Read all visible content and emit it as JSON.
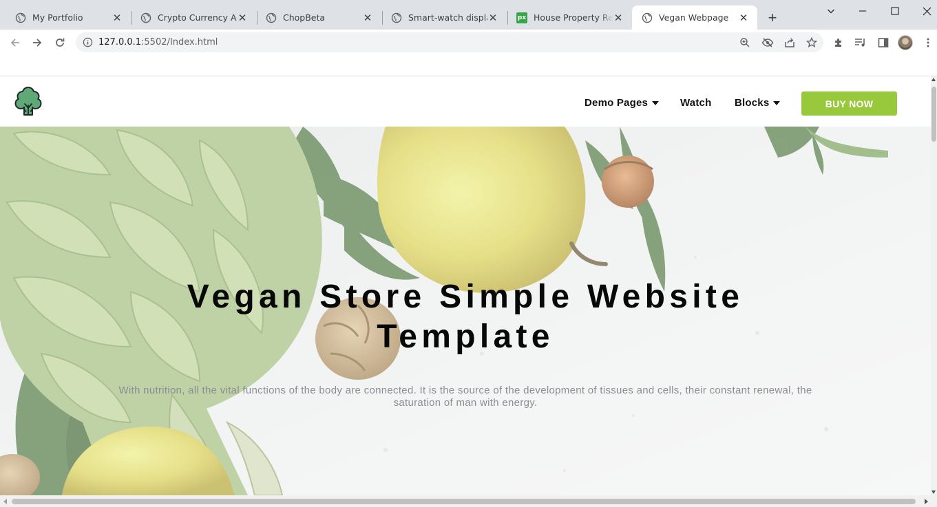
{
  "browser": {
    "tabs": [
      {
        "title": "My Portfolio",
        "favicon": "globe-icon"
      },
      {
        "title": "Crypto Currency App",
        "favicon": "globe-icon"
      },
      {
        "title": "ChopBeta",
        "favicon": "globe-icon"
      },
      {
        "title": "Smart-watch display",
        "favicon": "globe-icon"
      },
      {
        "title": "House Property Real E",
        "favicon": "px-icon"
      },
      {
        "title": "Vegan Webpage",
        "favicon": "globe-icon",
        "active": true
      }
    ],
    "px_favicon_text": "px",
    "url_host": "127.0.0.1",
    "url_rest": ":5502/Index.html"
  },
  "site": {
    "nav": {
      "demo_pages": "Demo Pages",
      "watch": "Watch",
      "blocks": "Blocks",
      "buy_now": "BUY NOW"
    },
    "hero": {
      "title": "Vegan Store Simple Website Template",
      "subtitle": "With nutrition, all the vital functions of the body are connected. It is the source of the development of tissues and cells, their constant renewal, the saturation of man with energy."
    }
  },
  "colors": {
    "accent": "#98c93c",
    "tabbar": "#dee1e6",
    "logo_green": "#5fa877"
  }
}
